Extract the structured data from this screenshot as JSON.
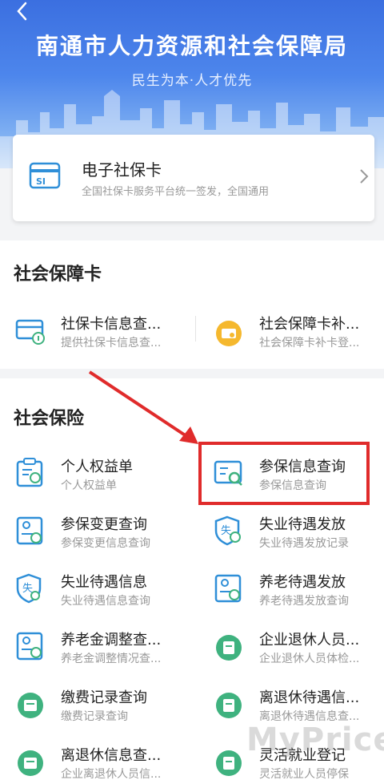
{
  "header": {
    "title": "南通市人力资源和社会保障局",
    "subtitle": "民生为本·人才优先"
  },
  "ecard": {
    "title": "电子社保卡",
    "subtitle": "全国社保卡服务平台统一签发，全国通用",
    "icon_text": "SI"
  },
  "section_card": {
    "title": "社会保障卡",
    "items": [
      {
        "title": "社保卡信息查...",
        "subtitle": "提供社保卡信息查..."
      },
      {
        "title": "社会保障卡补...",
        "subtitle": "社会保障卡补卡登..."
      }
    ]
  },
  "section_insurance": {
    "title": "社会保险",
    "items": [
      {
        "title": "个人权益单",
        "subtitle": "个人权益单"
      },
      {
        "title": "参保信息查询",
        "subtitle": "参保信息查询"
      },
      {
        "title": "参保变更查询",
        "subtitle": "参保变更信息查询"
      },
      {
        "title": "失业待遇发放",
        "subtitle": "失业待遇发放记录"
      },
      {
        "title": "失业待遇信息",
        "subtitle": "失业待遇信息查询"
      },
      {
        "title": "养老待遇发放",
        "subtitle": "养老待遇发放查询"
      },
      {
        "title": "养老金调整查...",
        "subtitle": "养老金调整情况查..."
      },
      {
        "title": "企业退休人员...",
        "subtitle": "企业退休人员体检..."
      },
      {
        "title": "缴费记录查询",
        "subtitle": "缴费记录查询"
      },
      {
        "title": "离退休待遇信...",
        "subtitle": "离退休待遇信息查..."
      },
      {
        "title": "离退休信息查...",
        "subtitle": "企业离退休人员信..."
      },
      {
        "title": "灵活就业登记",
        "subtitle": "灵活就业人员停保"
      }
    ]
  },
  "watermark": "MyPrice",
  "colors": {
    "brand_blue": "#3b6fe0",
    "icon_blue": "#2f8fd8",
    "icon_green": "#3fb27f",
    "icon_yellow": "#f5b82e",
    "highlight_red": "#e02b2b"
  }
}
